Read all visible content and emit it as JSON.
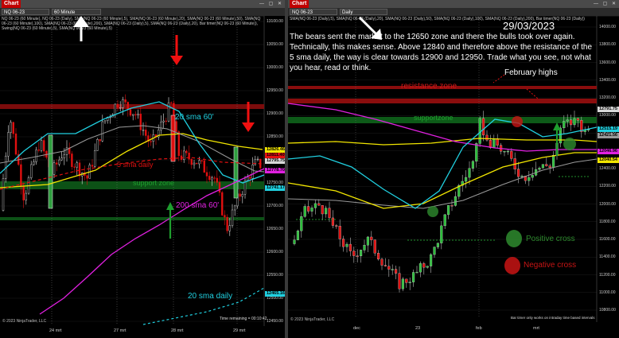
{
  "left": {
    "title": "Chart",
    "window_buttons": "— ▢ ✕",
    "instrument": "NQ 06-23",
    "interval": "60 Minute",
    "indicator_text": "NQ 06-23 (60 Minute), NQ 06-23 (Daily), SMA(NQ 06-23 (60 Minute),5), SMA(NQ 06-23 (60 Minute),20), SMA(NQ 06-23 (60 Minute),50), SMA(NQ 06-23 (60 Minute),100), SMA(NQ 06-23 (60 Minute),200), SMA(NQ 06-23 (Daily),5), SMA(NQ 06-23 (Daily),20), Bar timer(NQ 06-23 (60 Minute)), Swing(NQ 06-23 (60 Minute),5), SMA(NQ 06-23 (60 Minute),5)",
    "annotations": {
      "sma20_60": "20 sma 60'",
      "sma5_daily": "5 sma daily",
      "support_zone": "support zone",
      "sma200_60": "200 sma 60'",
      "sma20_daily": "20 sma daily"
    },
    "price_axis": [
      "13100.00",
      "13050.00",
      "13000.00",
      "12950.00",
      "12900.00",
      "12850.00",
      "12800.00",
      "12750.00",
      "12700.00",
      "12650.00",
      "12600.00",
      "12550.00",
      "12500.00",
      "12450.00"
    ],
    "price_tags": [
      {
        "text": "12826.46",
        "color": "#f2e600"
      },
      {
        "text": "12811.40",
        "color": "#e01010"
      },
      {
        "text": "12795.75",
        "color": "#d8d8d8"
      },
      {
        "text": "12778.70",
        "color": "#e020e0"
      },
      {
        "text": "12741.17",
        "color": "#20d0e0"
      },
      {
        "text": "12465.16",
        "color": "#20d0e0"
      }
    ],
    "dates": [
      "24 mrt",
      "27 mrt",
      "28 mrt",
      "29 mrt"
    ],
    "timer": "Time remaining = 00:10:42",
    "copyright": "© 2023 NinjaTrader, LLC"
  },
  "right": {
    "title": "Chart",
    "window_buttons": "— ▢ ✕",
    "instrument": "NQ 06-23",
    "interval": "Daily",
    "indicator_text": "SMA(NQ 06-23 (Daily),5), SMA(NQ 06-23 (Daily),20), SMA(NQ 06-23 (Daily),50), SMA(NQ 06-23 (Daily),100), SMA(NQ 06-23 (Daily),200), Bar timer(NQ 06-23 (Daily))",
    "date_heading": "29/03/2023",
    "commentary": "The bears sent the market to the 12650 zone and there the bulls took over again. Technically, this makes sense. Above 12840 and therefore above the resistance of the 5 sma daily, the way is clear towards 12900 and 12950. Trade what you see, not what you hear, read or think.",
    "february_highs": "February highs",
    "resistance_zone": "resistance zone",
    "support_zone": "supportzone",
    "legend": {
      "positive": "Positive cross",
      "negative": "Negative cross"
    },
    "price_axis": [
      "14000.00",
      "13800.00",
      "13600.00",
      "13400.00",
      "13200.00",
      "13000.00",
      "12800.00",
      "12600.00",
      "12400.00",
      "12200.00",
      "12000.00",
      "11800.00",
      "11600.00",
      "11400.00",
      "11200.00",
      "11000.00",
      "10800.00"
    ],
    "price_tags": [
      {
        "text": "12791.75",
        "color": "#d8d8d8"
      },
      {
        "text": "12515.19",
        "color": "#20d0e0"
      },
      {
        "text": "12421.56",
        "color": "#9a9a9a"
      },
      {
        "text": "12046.96",
        "color": "#e020e0"
      },
      {
        "text": "12040.54",
        "color": "#f2e600"
      }
    ],
    "dates": [
      "dec",
      "23",
      "feb",
      "mrt"
    ],
    "timer_note": "Bar timer only works on intraday time based intervals",
    "copyright": "© 2023 NinjaTrader, LLC",
    "colors": {
      "positive": "#2e8b2e",
      "negative": "#c81414",
      "resistance": "#8a0d0d",
      "support": "#0d5a18"
    }
  }
}
